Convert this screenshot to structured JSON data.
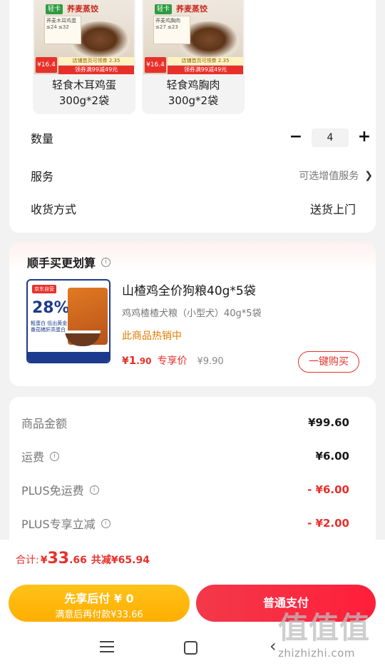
{
  "variants": [
    {
      "brand": "轻卡",
      "brand_title": "荞麦蒸饺",
      "pack_text": "荞麦木耳鸡蛋 ≤24 ≤32",
      "price_tag": "¥16.4",
      "promo_small": "店铺首页可领券 2.35",
      "promo": "领券满99减49元",
      "name_line1": "轻食木耳鸡蛋",
      "name_line2": "300g*2袋"
    },
    {
      "brand": "轻卡",
      "brand_title": "荞麦蒸饺",
      "pack_text": "荞麦鸡胸肉 ≤27 ≤23",
      "price_tag": "¥16.4",
      "promo_small": "店铺首页可领券 2.35",
      "promo": "领券满99减49元",
      "name_line1": "轻食鸡胸肉",
      "name_line2": "300g*2袋"
    }
  ],
  "quantity": {
    "label": "数量",
    "minus": "−",
    "value": "4",
    "plus": "+"
  },
  "service": {
    "label": "服务",
    "value": "可选增值服务"
  },
  "delivery": {
    "label": "收货方式",
    "value": "送货上门"
  },
  "bundle": {
    "title": "顺手买更划算",
    "image": {
      "tag": "京东自营",
      "big": "28%",
      "sub": "粗蛋白 低出黄金番茄猪肝高蛋白"
    },
    "name": "山楂鸡全价狗粮40g*5袋",
    "desc": "鸡鸡楂楂犬粮（小型犬）40g*5袋",
    "hot": "此商品热销中",
    "price_currency": "¥",
    "price_int": "1",
    "price_dec": ".90",
    "price_label": "专享价",
    "orig_price": "¥9.90",
    "buy_button": "一键购买"
  },
  "summary": {
    "rows": [
      {
        "label": "商品金额",
        "value": "¥99.60"
      },
      {
        "label": "运费",
        "value": "¥6.00"
      },
      {
        "label": "PLUS免运费",
        "value": "- ¥6.00"
      },
      {
        "label": "PLUS专享立减",
        "value": "- ¥2.00"
      }
    ]
  },
  "total": {
    "label": "合计:",
    "currency": "¥",
    "int": "33",
    "dec": ".66",
    "saved": "共减¥65.94"
  },
  "buttons": {
    "pay_later_line1": "先享后付 ¥ 0",
    "pay_later_line2": "满意后再付款¥33.66",
    "pay_now": "普通支付"
  },
  "watermark": {
    "glyphs": "值值值",
    "url": "zhizhizhi.com"
  },
  "colors": {
    "accent": "#e8302a",
    "pay_later": "#ffb000",
    "pay_now": "#f3384a"
  }
}
